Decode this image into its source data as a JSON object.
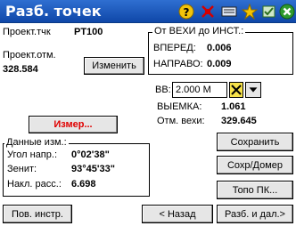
{
  "title": "Разб. точек",
  "toolbar_icons": [
    "question-icon",
    "satellite-icon",
    "keyboard-icon",
    "star-icon",
    "settings-icon",
    "close-icon"
  ],
  "project": {
    "label": "Проект.тчк",
    "value": "PT100",
    "elev_label": "Проект.отм.",
    "elev_value": "328.584",
    "edit_button": "Изменить"
  },
  "from_rod": {
    "title": "От ВЕХИ до ИНСТ.:",
    "forward_label": "ВПЕРЕД:",
    "forward_value": "0.006",
    "right_label": "НАПРАВО:",
    "right_value": "0.009"
  },
  "rod_height": {
    "label": "ВВ:",
    "value": "2.000 М"
  },
  "cut": {
    "label": "ВЫЕМКА:",
    "value": "1.061"
  },
  "rod_elev": {
    "label": "Отм. вехи:",
    "value": "329.645"
  },
  "measure_button": "Измер...",
  "measurement_data": {
    "title": "Данные изм.:",
    "hz_label": "Угол напр.:",
    "hz_value": "0°02'38\"",
    "zenith_label": "Зенит:",
    "zenith_value": "93°45'33\"",
    "slope_label": "Накл. расс.:",
    "slope_value": "6.698"
  },
  "side_buttons": {
    "save": "Сохранить",
    "save_more": "Сохр/Домер",
    "topo": "Топо ПК..."
  },
  "bottom_buttons": {
    "station": "Пов. инстр.",
    "back": "< Назад",
    "stake_next": "Разб. и дал.>"
  },
  "colors": {
    "titlebar": "#1a55bf",
    "measure_text": "#e00000"
  }
}
